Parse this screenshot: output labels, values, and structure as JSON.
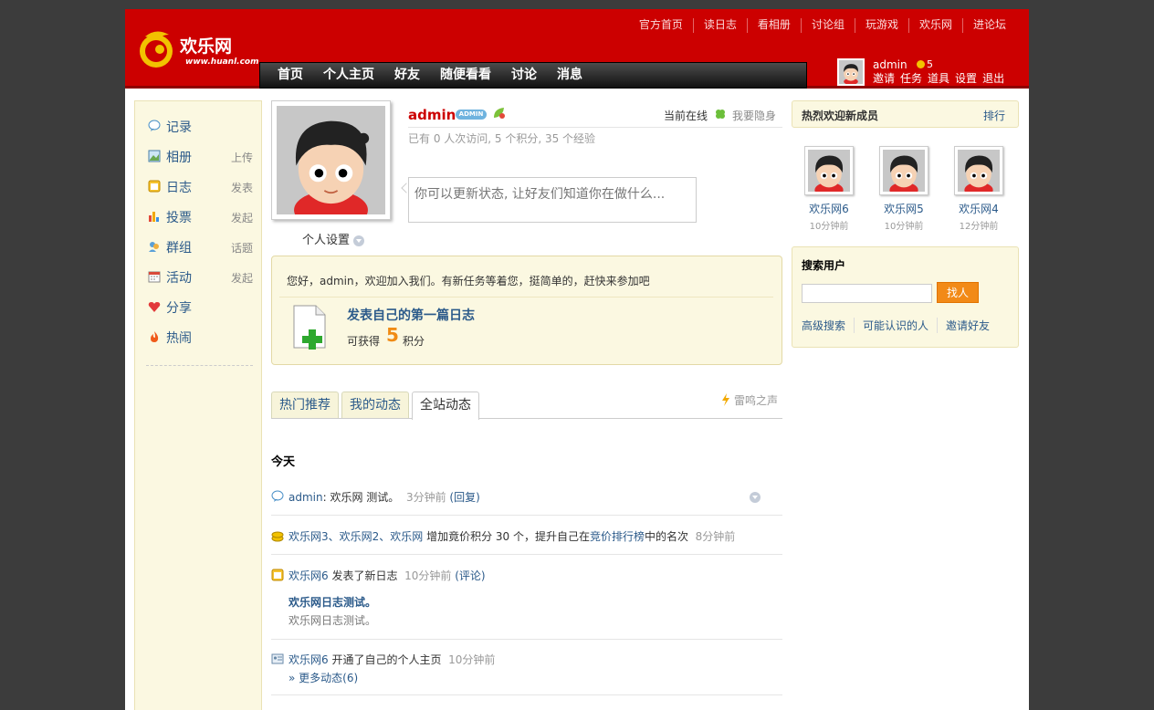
{
  "header": {
    "logo_text": "欢乐网",
    "logo_sub": "www.huanl.com",
    "top_links": [
      "官方首页",
      "读日志",
      "看相册",
      "讨论组",
      "玩游戏",
      "欢乐网",
      "进论坛"
    ],
    "nav": [
      "首页",
      "个人主页",
      "好友",
      "随便看看",
      "讨论",
      "消息"
    ],
    "user": {
      "name": "admin",
      "coins": "5",
      "links": [
        "邀请",
        "任务",
        "道具",
        "设置",
        "退出"
      ]
    }
  },
  "sidebar": {
    "items": [
      {
        "label": "记录",
        "action": "",
        "icon": "speech-bubble-icon"
      },
      {
        "label": "相册",
        "action": "上传",
        "icon": "photo-icon"
      },
      {
        "label": "日志",
        "action": "发表",
        "icon": "notepad-icon"
      },
      {
        "label": "投票",
        "action": "发起",
        "icon": "bar-chart-icon"
      },
      {
        "label": "群组",
        "action": "话题",
        "icon": "group-icon"
      },
      {
        "label": "活动",
        "action": "发起",
        "icon": "calendar-icon"
      },
      {
        "label": "分享",
        "action": "",
        "icon": "heart-icon"
      },
      {
        "label": "热闹",
        "action": "",
        "icon": "fire-icon"
      }
    ]
  },
  "profile": {
    "name": "admin",
    "badge": "ADMIN",
    "online_text": "当前在线",
    "hide_text": "我要隐身",
    "stats": "已有  0 人次访问, 5 个积分, 35 个经验",
    "settings": "个人设置",
    "status_placeholder": "你可以更新状态, 让好友们知道你在做什么..."
  },
  "task": {
    "greeting": "您好，admin，欢迎加入我们。有新任务等着您，挺简单的，赶快来参加吧",
    "title": "发表自己的第一篇日志",
    "earn_label": "可获得",
    "points": "5",
    "unit": "积分"
  },
  "tabs": [
    "热门推荐",
    "我的动态",
    "全站动态"
  ],
  "voice": "雷鸣之声",
  "feed": {
    "today": "今天",
    "item1": {
      "user": "admin",
      "text": ": 欢乐网  测试。",
      "time": "3分钟前",
      "reply": "(回复)"
    },
    "item2": {
      "users": "欢乐网3、欢乐网2、欢乐网",
      "text": "  增加竟价积分  30 个，提升自己在",
      "rank_link": "竞价排行榜",
      "text2": "中的名次",
      "time": "8分钟前"
    },
    "item3": {
      "user": "欢乐网6",
      "text": " 发表了新日志",
      "time": "10分钟前",
      "comment": "(评论)",
      "blog_title": "欢乐网日志测试。",
      "blog_summary": "欢乐网日志测试。"
    },
    "item4": {
      "user": "欢乐网6",
      "text": " 开通了自己的个人主页",
      "time": "10分钟前",
      "more": "» 更多动态(6)"
    }
  },
  "right": {
    "new_members_title": "热烈欢迎新成员",
    "rank": "排行",
    "members": [
      {
        "name": "欢乐网6",
        "time": "10分钟前"
      },
      {
        "name": "欢乐网5",
        "time": "10分钟前"
      },
      {
        "name": "欢乐网4",
        "time": "12分钟前"
      }
    ],
    "search_title": "搜索用户",
    "search_button": "找人",
    "search_links": [
      "高级搜索",
      "可能认识的人",
      "邀请好友"
    ]
  },
  "colors": {
    "header_red": "#cc0000",
    "link_blue": "#2b5a8a",
    "panel_bg": "#fbf8e1",
    "accent_orange": "#f28a17"
  }
}
